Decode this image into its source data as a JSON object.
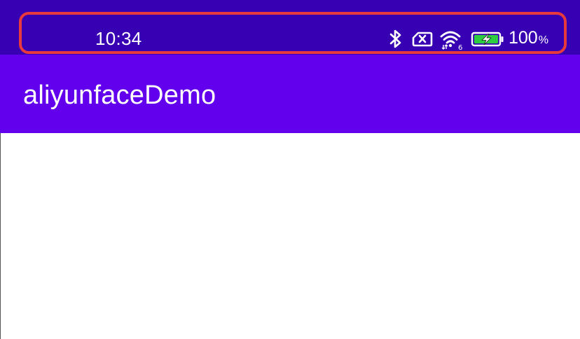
{
  "status_bar": {
    "time": "10:34",
    "icons": [
      "bluetooth-icon",
      "sim-no-service-icon",
      "wifi-icon",
      "battery-charging-icon"
    ],
    "battery_percent": "100",
    "battery_percent_sign": "%",
    "battery_level": 1.0
  },
  "app_bar": {
    "title": "aliyunfaceDemo"
  },
  "colors": {
    "status_bar_bg": "#3700b3",
    "app_bar_bg": "#6200ee",
    "highlight": "#e8393c",
    "battery_fill": "#2ecc40",
    "content_bg": "#ffffff"
  }
}
